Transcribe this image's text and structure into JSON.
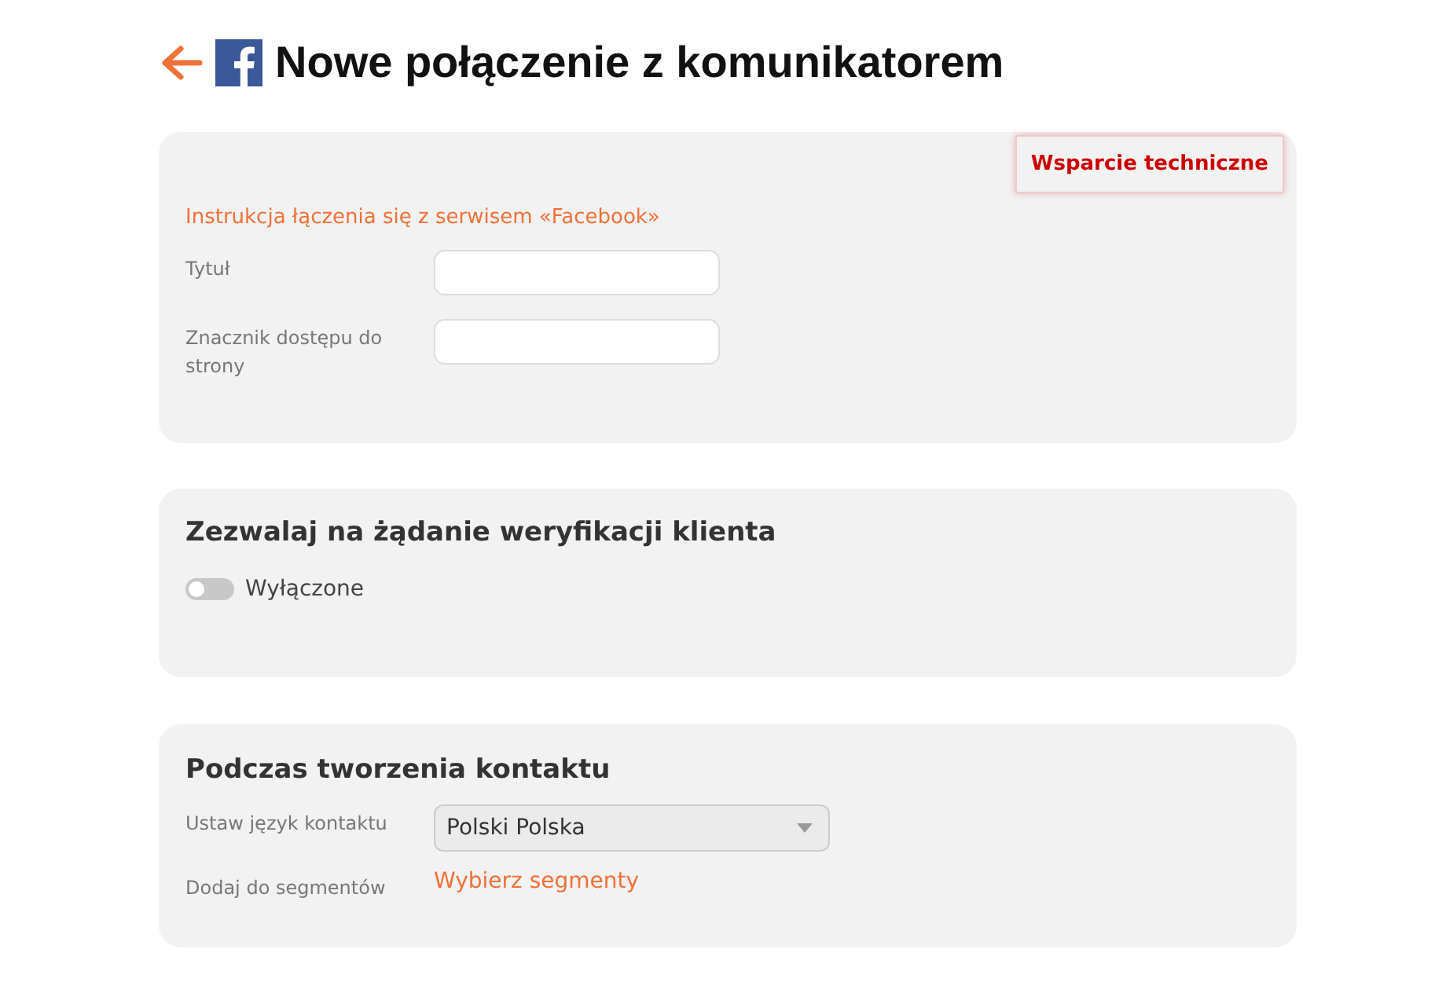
{
  "header": {
    "title": "Nowe połączenie z komunikatorem"
  },
  "connection": {
    "support_button": "Wsparcie techniczne",
    "instruction_link": "Instrukcja łączenia się z serwisem «Facebook»",
    "fields": [
      {
        "label": "Tytuł"
      },
      {
        "label": "Znacznik dostępu do strony"
      }
    ]
  },
  "verification": {
    "title": "Zezwalaj na żądanie weryfikacji klienta",
    "toggle": {
      "on": false,
      "label": "Wyłączone"
    }
  },
  "contact_creation": {
    "title": "Podczas tworzenia kontaktu",
    "language": {
      "label": "Ustaw język kontaktu",
      "value": "Polski Polska"
    },
    "segments": {
      "label": "Dodaj do segmentów",
      "link": "Wybierz segmenty"
    }
  }
}
